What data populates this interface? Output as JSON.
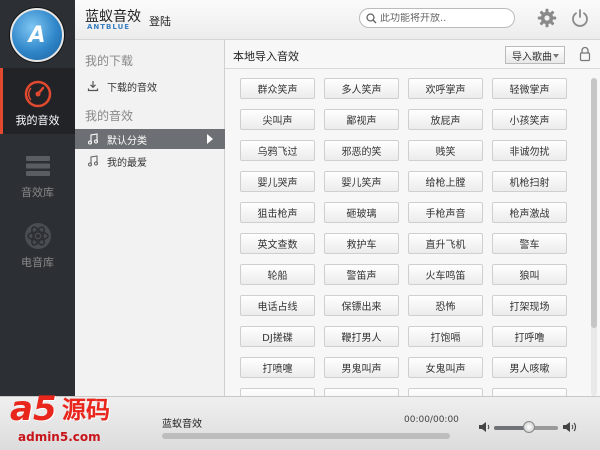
{
  "app": {
    "brand_cn": "蓝蚁音效",
    "brand_en": "ANTBLUE",
    "login_label": "登陆"
  },
  "header": {
    "search_placeholder": "此功能将开放.."
  },
  "nav": {
    "items": [
      {
        "label": "我的音效",
        "icon": "speedometer-icon",
        "active": true
      },
      {
        "label": "音效库",
        "icon": "stack-icon",
        "active": false
      },
      {
        "label": "电音库",
        "icon": "atom-icon",
        "active": false
      }
    ]
  },
  "categories": {
    "downloads_heading": "我的下载",
    "downloaded_label": "下载的音效",
    "my_sounds_heading": "我的音效",
    "default_label": "默认分类",
    "favorites_label": "我的最爱"
  },
  "main": {
    "title": "本地导入音效",
    "import_label": "导入歌曲",
    "sounds": [
      "群众笑声",
      "多人笑声",
      "欢呼掌声",
      "轻微掌声",
      "尖叫声",
      "鄙视声",
      "放屁声",
      "小孩笑声",
      "乌鸦飞过",
      "邪恶的笑",
      "贱笑",
      "非诚勿扰",
      "婴儿哭声",
      "婴儿笑声",
      "给枪上膛",
      "机枪扫射",
      "狙击枪声",
      "砸玻璃",
      "手枪声音",
      "枪声激战",
      "英文查数",
      "救护车",
      "直升飞机",
      "警车",
      "轮船",
      "警笛声",
      "火车鸣笛",
      "狼叫",
      "电话占线",
      "保镖出来",
      "恐怖",
      "打架现场",
      "DJ搓碟",
      "鞭打男人",
      "打饱嗝",
      "打呼噜",
      "打喷嚏",
      "男鬼叫声",
      "女鬼叫声",
      "男人咳嗽",
      "",
      "",
      "",
      ""
    ]
  },
  "player": {
    "now_title": "蓝蚁音效",
    "time": "00:00/00:00",
    "volume": 0.55
  },
  "watermark": {
    "logo_a5": "a5",
    "logo_cn": "源码",
    "url": "admin5.com"
  },
  "colors": {
    "accent": "#e2492f",
    "sidebar": "#2c2f33",
    "selected_row": "#6c6f73"
  }
}
